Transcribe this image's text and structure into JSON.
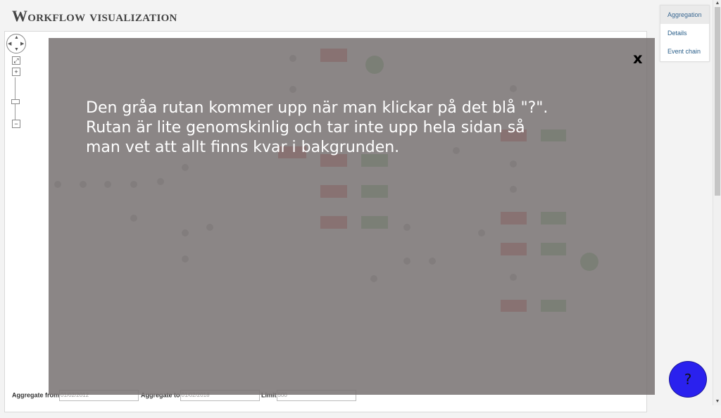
{
  "page": {
    "title": "Workflow visualization"
  },
  "side_nav": {
    "tabs": [
      {
        "label": "Aggregation",
        "active": true
      },
      {
        "label": "Details",
        "active": false
      },
      {
        "label": "Event chain",
        "active": false
      }
    ]
  },
  "filters": {
    "from": {
      "label": "Aggregate from",
      "value": "01/02/2012"
    },
    "to": {
      "label": "Aggregate to",
      "value": "01/02/2018"
    },
    "limit": {
      "label": "Limit",
      "value": "500"
    }
  },
  "overlay": {
    "close_label": "x",
    "lines": [
      "Den gråa rutan kommer upp när man klickar på det blå \"?\".",
      "Rutan är lite genomskinlig och tar inte upp hela sidan så",
      "man vet att allt finns kvar i bakgrunden."
    ]
  },
  "help_button": {
    "label": "?",
    "color": "#2a21ee"
  },
  "colors": {
    "overlay": "#7a7373",
    "node_red": "#e57373",
    "node_green": "#8fc98f"
  }
}
